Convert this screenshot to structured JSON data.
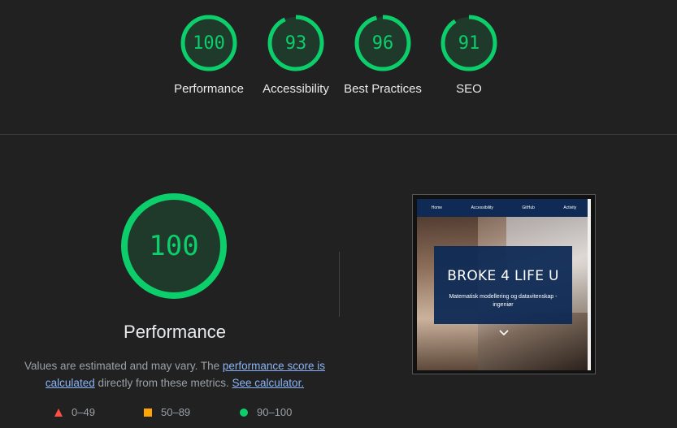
{
  "categories": [
    {
      "score": "100",
      "label": "Performance",
      "value": 100
    },
    {
      "score": "93",
      "label": "Accessibility",
      "value": 93
    },
    {
      "score": "96",
      "label": "Best Practices",
      "value": 96
    },
    {
      "score": "91",
      "label": "SEO",
      "value": 91
    }
  ],
  "performance": {
    "score": "100",
    "value": 100,
    "title": "Performance",
    "description_prefix": "Values are estimated and may vary. The ",
    "description_link": "performance score is calculated",
    "description_middle": " directly from these metrics. ",
    "calculator_link": "See calculator."
  },
  "legend": [
    {
      "range": "0–49",
      "shape": "triangle",
      "color": "#ff4e42"
    },
    {
      "range": "50–89",
      "shape": "square",
      "color": "#ffa400"
    },
    {
      "range": "90–100",
      "shape": "circle",
      "color": "#0cce6b"
    }
  ],
  "screenshot": {
    "nav": [
      "Home",
      "Accessibility",
      "GitHub",
      "Activity"
    ],
    "hero_title": "BROKE 4 LIFE U",
    "hero_subtitle": "Matematisk modellering og datavitenskap - ingeniør"
  },
  "colors": {
    "pass": "#0cce6b",
    "pass_bg": "#1e3a2b",
    "background": "#212121"
  }
}
